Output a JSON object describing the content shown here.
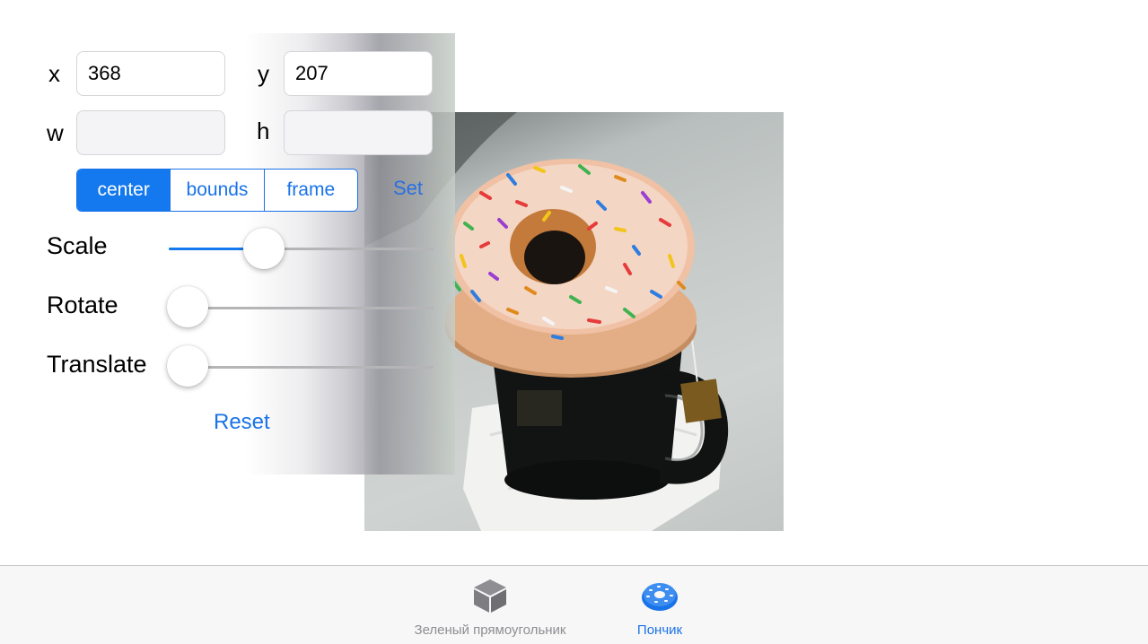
{
  "panel": {
    "x_label": "x",
    "y_label": "y",
    "w_label": "w",
    "h_label": "h",
    "x_value": "368",
    "y_value": "207",
    "w_value": "",
    "h_value": "",
    "segments": [
      "center",
      "bounds",
      "frame"
    ],
    "selected_segment": "center",
    "set_label": "Set",
    "sliders": [
      {
        "label": "Scale",
        "level": 0.36
      },
      {
        "label": "Rotate",
        "level": 0.0
      },
      {
        "label": "Translate",
        "level": 0.0
      }
    ],
    "reset_label": "Reset"
  },
  "image": {
    "icon": "donut-photo"
  },
  "tabbar": {
    "items": [
      {
        "label": "Зеленый прямоугольник",
        "icon": "cube-icon",
        "selected": false
      },
      {
        "label": "Пончик",
        "icon": "donut-icon",
        "selected": true
      }
    ]
  },
  "colors": {
    "accent": "#1478ee",
    "inactive_tab": "#8e8e93"
  }
}
